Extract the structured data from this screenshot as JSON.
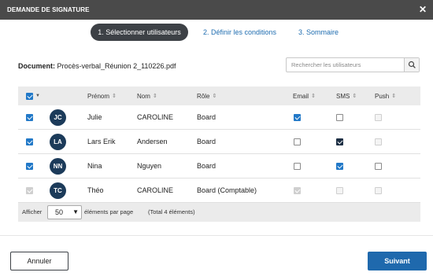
{
  "dialog": {
    "title": "DEMANDE DE SIGNATURE",
    "close_icon": "close-icon"
  },
  "steps": [
    {
      "label": "1. Sélectionner utilisateurs",
      "active": true
    },
    {
      "label": "2. Définir les conditions",
      "active": false
    },
    {
      "label": "3. Sommaire",
      "active": false
    }
  ],
  "document": {
    "label": "Document:",
    "name": "Procès-verbal_Réunion 2_110226.pdf"
  },
  "search": {
    "placeholder": "Rechercher les utilisateurs",
    "value": "",
    "icon": "search-icon"
  },
  "table": {
    "headers": {
      "prenom": "Prénom",
      "nom": "Nom",
      "role": "Rôle",
      "email": "Email",
      "sms": "SMS",
      "push": "Push"
    },
    "select_all_checked": true,
    "rows": [
      {
        "initials": "JC",
        "prenom": "Julie",
        "nom": "CAROLINE",
        "role": "Board",
        "selected": true,
        "disabled": false,
        "email": true,
        "sms": false,
        "push": false,
        "push_enabled": false
      },
      {
        "initials": "LA",
        "prenom": "Lars Erik",
        "nom": "Andersen",
        "role": "Board",
        "selected": true,
        "disabled": false,
        "email": false,
        "sms": true,
        "push": false,
        "push_enabled": false
      },
      {
        "initials": "NN",
        "prenom": "Nina",
        "nom": "Nguyen",
        "role": "Board",
        "selected": true,
        "disabled": false,
        "email": false,
        "sms": true,
        "push": false,
        "push_enabled": true
      },
      {
        "initials": "TC",
        "prenom": "Théo",
        "nom": "CAROLINE",
        "role": "Board (Comptable)",
        "selected": true,
        "disabled": true,
        "email": true,
        "sms": false,
        "push": false,
        "push_enabled": false
      }
    ]
  },
  "pagination": {
    "show_label": "Afficher",
    "page_size": "50",
    "per_page_label": "éléments par page",
    "total_label": "(Total 4 éléments)"
  },
  "buttons": {
    "cancel": "Annuler",
    "next": "Suivant"
  },
  "colors": {
    "titlebar": "#4a4a4a",
    "accent": "#1f69ad",
    "avatar": "#1c3b5a",
    "checkbox": "#2279c8"
  }
}
